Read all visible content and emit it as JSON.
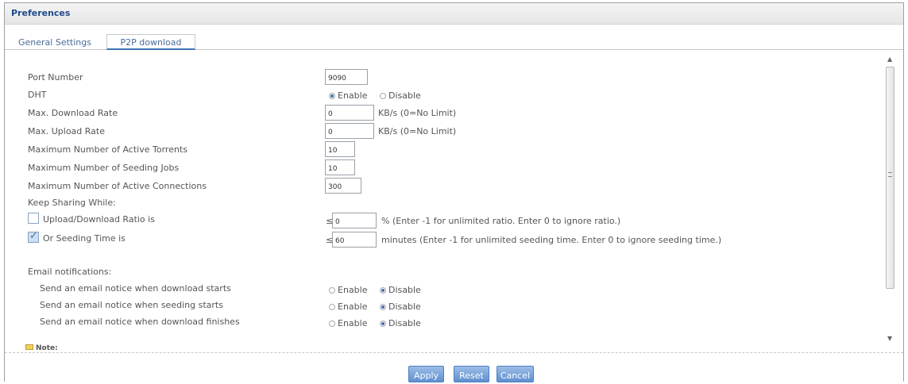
{
  "window": {
    "title": "Preferences"
  },
  "tabs": [
    {
      "label": "General Settings",
      "active": false
    },
    {
      "label": "P2P download",
      "active": true
    }
  ],
  "settings": {
    "port": {
      "label": "Port Number",
      "value": "9090"
    },
    "dht": {
      "label": "DHT",
      "enable_label": "Enable",
      "disable_label": "Disable",
      "selected": "enable"
    },
    "max_download": {
      "label": "Max. Download Rate",
      "value": "0",
      "unit": "KB/s (0=No Limit)"
    },
    "max_upload": {
      "label": "Max. Upload Rate",
      "value": "0",
      "unit": "KB/s (0=No Limit)"
    },
    "active_torrents": {
      "label": "Maximum Number of Active Torrents",
      "value": "10"
    },
    "seeding_jobs": {
      "label": "Maximum Number of Seeding Jobs",
      "value": "10"
    },
    "active_connections": {
      "label": "Maximum Number of Active Connections",
      "value": "300"
    },
    "keep_sharing": {
      "label": "Keep Sharing While:"
    },
    "ratio": {
      "label": "Upload/Download Ratio is",
      "checked": false,
      "le": "≤",
      "value": "0",
      "hint": "% (Enter -1 for unlimited ratio. Enter 0 to ignore ratio.)"
    },
    "seeding_time": {
      "label": "Or Seeding Time is",
      "checked": true,
      "le": "≤",
      "value": "60",
      "hint": "minutes (Enter -1 for unlimited seeding time. Enter 0 to ignore seeding time.)"
    }
  },
  "email": {
    "heading": "Email notifications:",
    "enable_label": "Enable",
    "disable_label": "Disable",
    "items": [
      {
        "label": "Send an email notice when download starts",
        "selected": "disable"
      },
      {
        "label": "Send an email notice when seeding starts",
        "selected": "disable"
      },
      {
        "label": "Send an email notice when download finishes",
        "selected": "disable"
      }
    ]
  },
  "note": {
    "label": "Note:"
  },
  "buttons": {
    "apply": "Apply",
    "reset": "Reset",
    "cancel": "Cancel"
  },
  "colors": {
    "accent": "#3f74b5",
    "title": "#1e4a8a",
    "button": "#5f8fd0"
  }
}
